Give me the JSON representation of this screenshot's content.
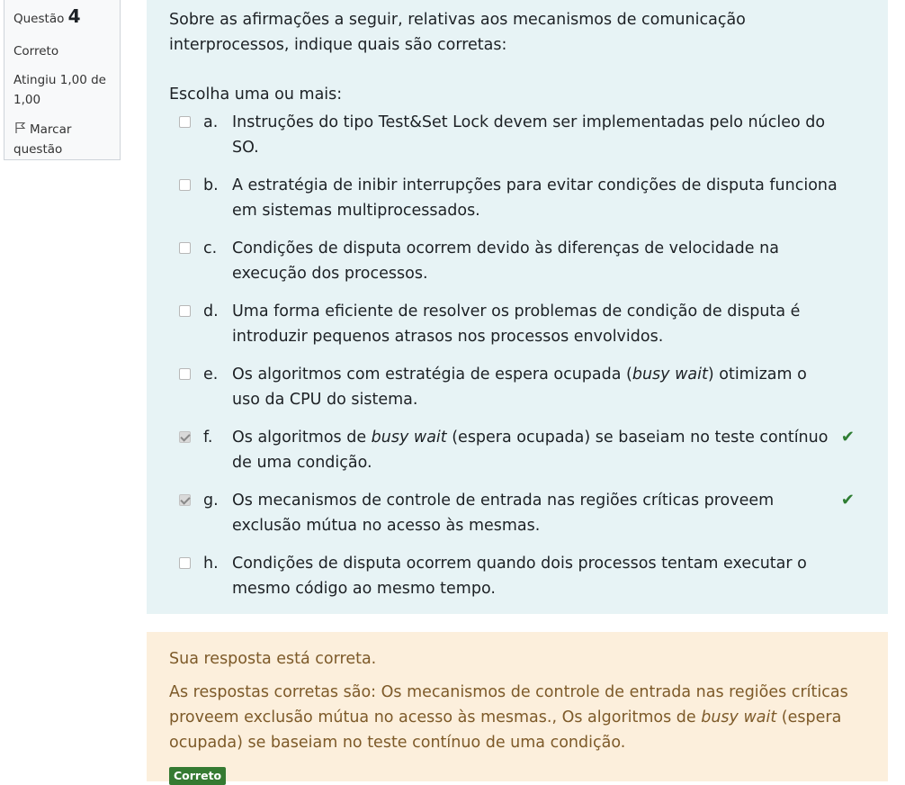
{
  "question_info": {
    "label": "Questão",
    "number": "4",
    "state": "Correto",
    "grade": "Atingiu 1,00 de 1,00",
    "flag_label": "Marcar questão"
  },
  "question": {
    "text": "Sobre as afirmações a seguir, relativas aos mecanismos de comunicação interprocessos, indique quais são corretas:",
    "prompt": "Escolha uma ou mais:",
    "options": [
      {
        "letter": "a.",
        "text": "Instruções do tipo Test&Set Lock devem ser implementadas pelo núcleo do SO.",
        "checked": false,
        "correct_mark": false
      },
      {
        "letter": "b.",
        "text": "A estratégia de inibir interrupções para evitar condições de disputa funciona em sistemas multiprocessados.",
        "checked": false,
        "correct_mark": false
      },
      {
        "letter": "c.",
        "text": "Condições de disputa ocorrem devido às diferenças de velocidade na execução dos processos.",
        "checked": false,
        "correct_mark": false
      },
      {
        "letter": "d.",
        "text": "Uma forma eficiente de resolver os problemas de condição de disputa é introduzir pequenos atrasos nos processos envolvidos.",
        "checked": false,
        "correct_mark": false
      },
      {
        "letter": "e.",
        "text_before": "Os algoritmos com estratégia de espera ocupada (",
        "text_em": "busy wait",
        "text_after": ") otimizam o uso da CPU do sistema.",
        "checked": false,
        "correct_mark": false
      },
      {
        "letter": "f.",
        "text_before": "Os algoritmos de ",
        "text_em": "busy wait",
        "text_after": " (espera ocupada) se baseiam no teste contínuo de uma condição.",
        "checked": true,
        "correct_mark": true
      },
      {
        "letter": "g.",
        "text": "Os mecanismos de controle de entrada nas regiões críticas proveem exclusão mútua no acesso às mesmas.",
        "checked": true,
        "correct_mark": true
      },
      {
        "letter": "h.",
        "text": "Condições de disputa ocorrem quando dois processos tentam executar o mesmo código ao mesmo tempo.",
        "checked": false,
        "correct_mark": false
      }
    ]
  },
  "feedback": {
    "status": "Sua resposta está correta.",
    "answers_before": "As respostas corretas são: Os mecanismos de controle de entrada nas regiões críticas proveem exclusão mútua no acesso às mesmas., Os algoritmos de ",
    "answers_em": "busy wait",
    "answers_after": " (espera ocupada) se baseiam no teste contínuo de uma condição.",
    "badge": "Correto"
  },
  "colors": {
    "question_bg": "#e7f3f5",
    "feedback_bg": "#fcefdc",
    "feedback_text": "#7d5a29",
    "correct_green": "#357a32"
  }
}
